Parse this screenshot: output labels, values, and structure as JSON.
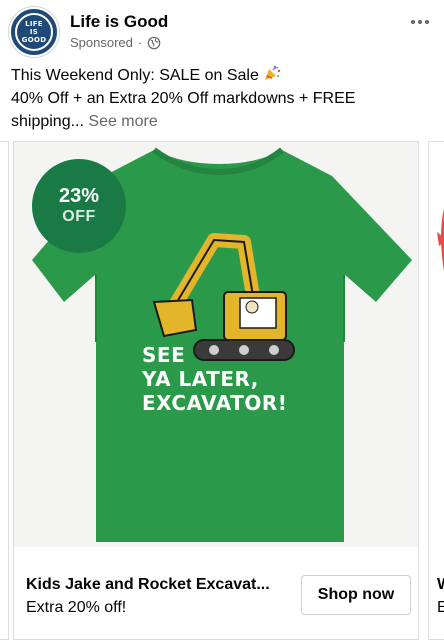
{
  "post": {
    "page_name": "Life is Good",
    "avatar_text": "LIFE\nIS\nGOOD",
    "sponsored": "Sponsored",
    "separator": "·",
    "text_line1": "This Weekend Only: SALE on Sale",
    "text_line2": "40% Off + an Extra 20% Off markdowns + FREE",
    "text_line3": "shipping...",
    "see_more": "See more"
  },
  "carousel": {
    "main_card": {
      "badge_percent": "23%",
      "badge_off": "OFF",
      "shirt_line1": "SEE",
      "shirt_line2": "YA LATER,",
      "shirt_line3": "EXCAVATOR!",
      "title": "Kids Jake and Rocket Excavat...",
      "subtitle": "Extra 20% off!",
      "cta": "Shop now"
    },
    "right_card": {
      "title_fragment": "W",
      "subtitle_fragment": "E"
    }
  },
  "colors": {
    "shirt_green": "#2a9a4a",
    "badge_green": "#1a7a45",
    "avatar_blue": "#1f4a78",
    "excavator_yellow": "#e2b52a"
  },
  "icons": {
    "more": "more-horizontal-icon",
    "audience": "globe-icon",
    "emoji": "party-popper-icon"
  }
}
